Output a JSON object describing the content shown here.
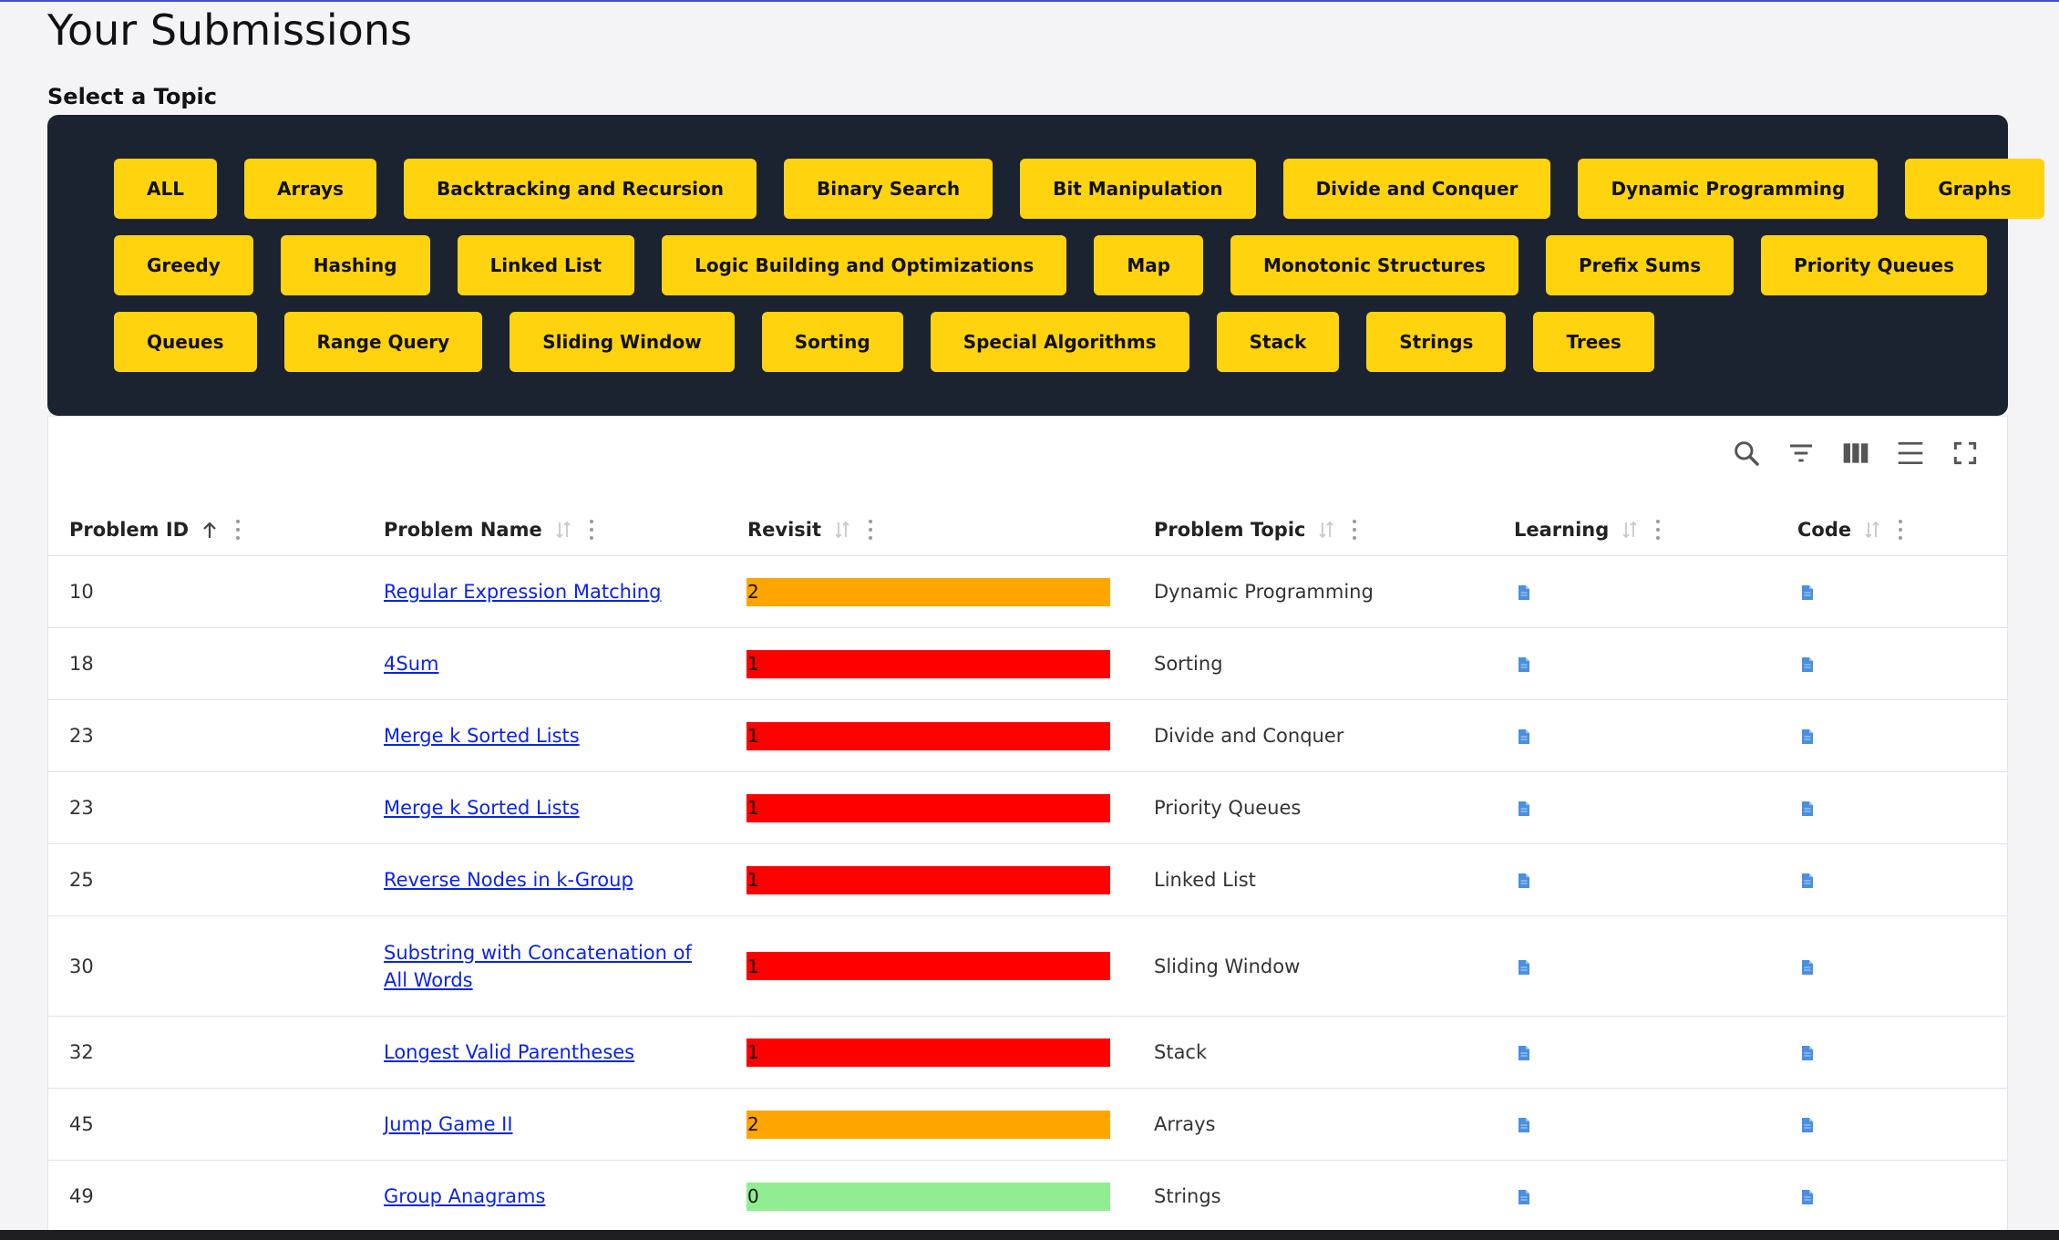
{
  "page": {
    "title": "Your Submissions"
  },
  "topics": {
    "label": "Select a Topic",
    "rows": [
      [
        "ALL",
        "Arrays",
        "Backtracking and Recursion",
        "Binary Search",
        "Bit Manipulation",
        "Divide and Conquer",
        "Dynamic Programming",
        "Graphs"
      ],
      [
        "Greedy",
        "Hashing",
        "Linked List",
        "Logic Building and Optimizations",
        "Map",
        "Monotonic Structures",
        "Prefix Sums",
        "Priority Queues"
      ],
      [
        "Queues",
        "Range Query",
        "Sliding Window",
        "Sorting",
        "Special Algorithms",
        "Stack",
        "Strings",
        "Trees"
      ]
    ]
  },
  "toolbar": [
    "search-icon",
    "filter-icon",
    "columns-icon",
    "density-icon",
    "fullscreen-icon"
  ],
  "table": {
    "columns": [
      {
        "label": "Problem ID",
        "sort": "asc"
      },
      {
        "label": "Problem Name",
        "sort": "none"
      },
      {
        "label": "Revisit",
        "sort": "none"
      },
      {
        "label": "Problem Topic",
        "sort": "none"
      },
      {
        "label": "Learning",
        "sort": "none"
      },
      {
        "label": "Code",
        "sort": "none"
      }
    ],
    "revisit_colors": {
      "0": "#90ee90",
      "1": "#ff0000",
      "2": "#ffa500"
    },
    "rows": [
      {
        "id": "10",
        "name": "Regular Expression Matching",
        "revisit": "2",
        "topic": "Dynamic Programming"
      },
      {
        "id": "18",
        "name": "4Sum",
        "revisit": "1",
        "topic": "Sorting"
      },
      {
        "id": "23",
        "name": "Merge k Sorted Lists",
        "revisit": "1",
        "topic": "Divide and Conquer"
      },
      {
        "id": "23",
        "name": "Merge k Sorted Lists",
        "revisit": "1",
        "topic": "Priority Queues"
      },
      {
        "id": "25",
        "name": "Reverse Nodes in k-Group",
        "revisit": "1",
        "topic": "Linked List"
      },
      {
        "id": "30",
        "name": "Substring with Concatenation of All Words",
        "revisit": "1",
        "topic": "Sliding Window"
      },
      {
        "id": "32",
        "name": "Longest Valid Parentheses",
        "revisit": "1",
        "topic": "Stack"
      },
      {
        "id": "45",
        "name": "Jump Game II",
        "revisit": "2",
        "topic": "Arrays"
      },
      {
        "id": "49",
        "name": "Group Anagrams",
        "revisit": "0",
        "topic": "Strings"
      }
    ]
  }
}
